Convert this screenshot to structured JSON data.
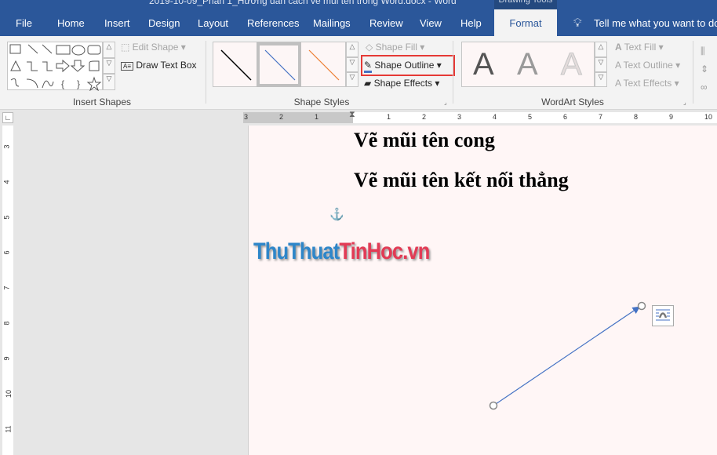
{
  "window": {
    "title": "2019-10-09_Phần 1_Hướng dẫn cách vẽ mũi tên trong Word.docx - Word",
    "context_tab_group": "Drawing Tools"
  },
  "tabs": [
    {
      "label": "File"
    },
    {
      "label": "Home"
    },
    {
      "label": "Insert"
    },
    {
      "label": "Design"
    },
    {
      "label": "Layout"
    },
    {
      "label": "References"
    },
    {
      "label": "Mailings"
    },
    {
      "label": "Review"
    },
    {
      "label": "View"
    },
    {
      "label": "Help"
    },
    {
      "label": "Format",
      "active": true
    }
  ],
  "tell_me": {
    "placeholder": "Tell me what you want to do",
    "icon": "lightbulb-icon"
  },
  "ribbon": {
    "insert_shapes": {
      "label": "Insert Shapes",
      "edit_shape": "Edit Shape",
      "draw_text_box": "Draw Text Box"
    },
    "shape_styles": {
      "label": "Shape Styles",
      "shape_fill": "Shape Fill",
      "shape_outline": "Shape Outline",
      "shape_effects": "Shape Effects",
      "style_colors": [
        "#000000",
        "#4472c4",
        "#ed7d31"
      ],
      "highlight_color": "#e53935"
    },
    "wordart_styles": {
      "label": "WordArt Styles",
      "text_fill": "Text Fill",
      "text_outline": "Text Outline",
      "text_effects": "Text Effects",
      "sample": "A"
    }
  },
  "ruler": {
    "horizontal_left": [
      "3",
      "2",
      "1"
    ],
    "horizontal": [
      "1",
      "2",
      "3",
      "4",
      "5",
      "6",
      "7",
      "8",
      "9",
      "10"
    ],
    "vertical": [
      "3",
      "4",
      "5",
      "6",
      "7",
      "8",
      "9",
      "10",
      "11"
    ]
  },
  "document": {
    "heading1": "Vẽ mũi tên cong",
    "heading2": "Vẽ mũi tên kết nối thẳng",
    "watermark": {
      "part1": "ThuThuat",
      "part2": "TinHoc",
      "part3": ".vn",
      "color1": "#2e86c9",
      "color2": "#e23b55"
    },
    "arrow_color": "#4472c4"
  }
}
